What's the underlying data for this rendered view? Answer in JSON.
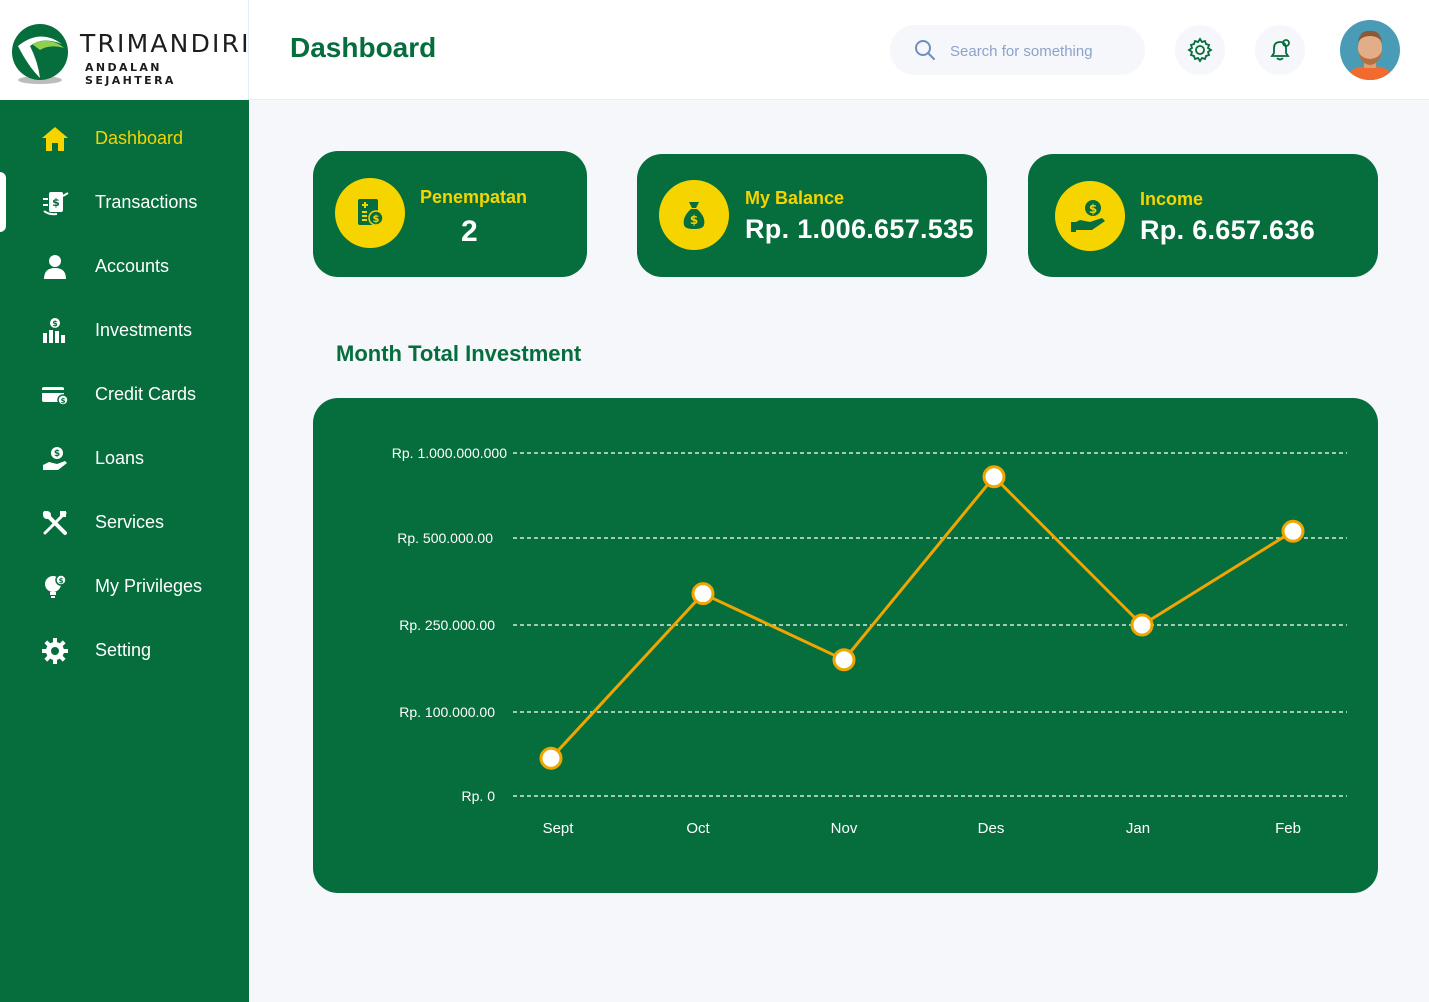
{
  "brand": {
    "name": "TRIMANDIRI",
    "tagline": "ANDALAN SEJAHTERA"
  },
  "header": {
    "title": "Dashboard",
    "search_placeholder": "Search for something"
  },
  "sidebar": {
    "items": [
      {
        "label": "Dashboard",
        "icon": "home-icon",
        "active": true
      },
      {
        "label": "Transactions",
        "icon": "transfer-icon"
      },
      {
        "label": "Accounts",
        "icon": "user-icon"
      },
      {
        "label": "Investments",
        "icon": "investment-icon"
      },
      {
        "label": "Credit Cards",
        "icon": "credit-card-icon"
      },
      {
        "label": "Loans",
        "icon": "loan-icon"
      },
      {
        "label": "Services",
        "icon": "tools-icon"
      },
      {
        "label": "My Privileges",
        "icon": "lightbulb-icon"
      },
      {
        "label": "Setting",
        "icon": "gear-icon"
      }
    ]
  },
  "cards": {
    "penempatan": {
      "label": "Penempatan",
      "value": "2"
    },
    "balance": {
      "label": "My Balance",
      "value": "Rp. 1.006.657.535"
    },
    "income": {
      "label": "Income",
      "value": "Rp. 6.657.636"
    }
  },
  "chart_section": {
    "title": "Month Total Investment"
  },
  "colors": {
    "primary_green": "#066d3d",
    "accent_yellow": "#f5d400",
    "line_orange": "#f0a500",
    "background": "#f5f7fa"
  },
  "chart_data": {
    "type": "line",
    "categories": [
      "Sept",
      "Oct",
      "Nov",
      "Des",
      "Jan",
      "Feb"
    ],
    "y_tick_labels": [
      "Rp. 1.000.000.000",
      "Rp. 500.000.00",
      "Rp. 250.000.00",
      "Rp. 100.000.00",
      "Rp. 0"
    ],
    "y_tick_values": [
      1000000000,
      500000000,
      250000000,
      100000000,
      0
    ],
    "series": [
      {
        "values": [
          45000000,
          340000000,
          190000000,
          860000000,
          250000000,
          540000000
        ]
      }
    ],
    "grid": true,
    "legend": "none"
  }
}
